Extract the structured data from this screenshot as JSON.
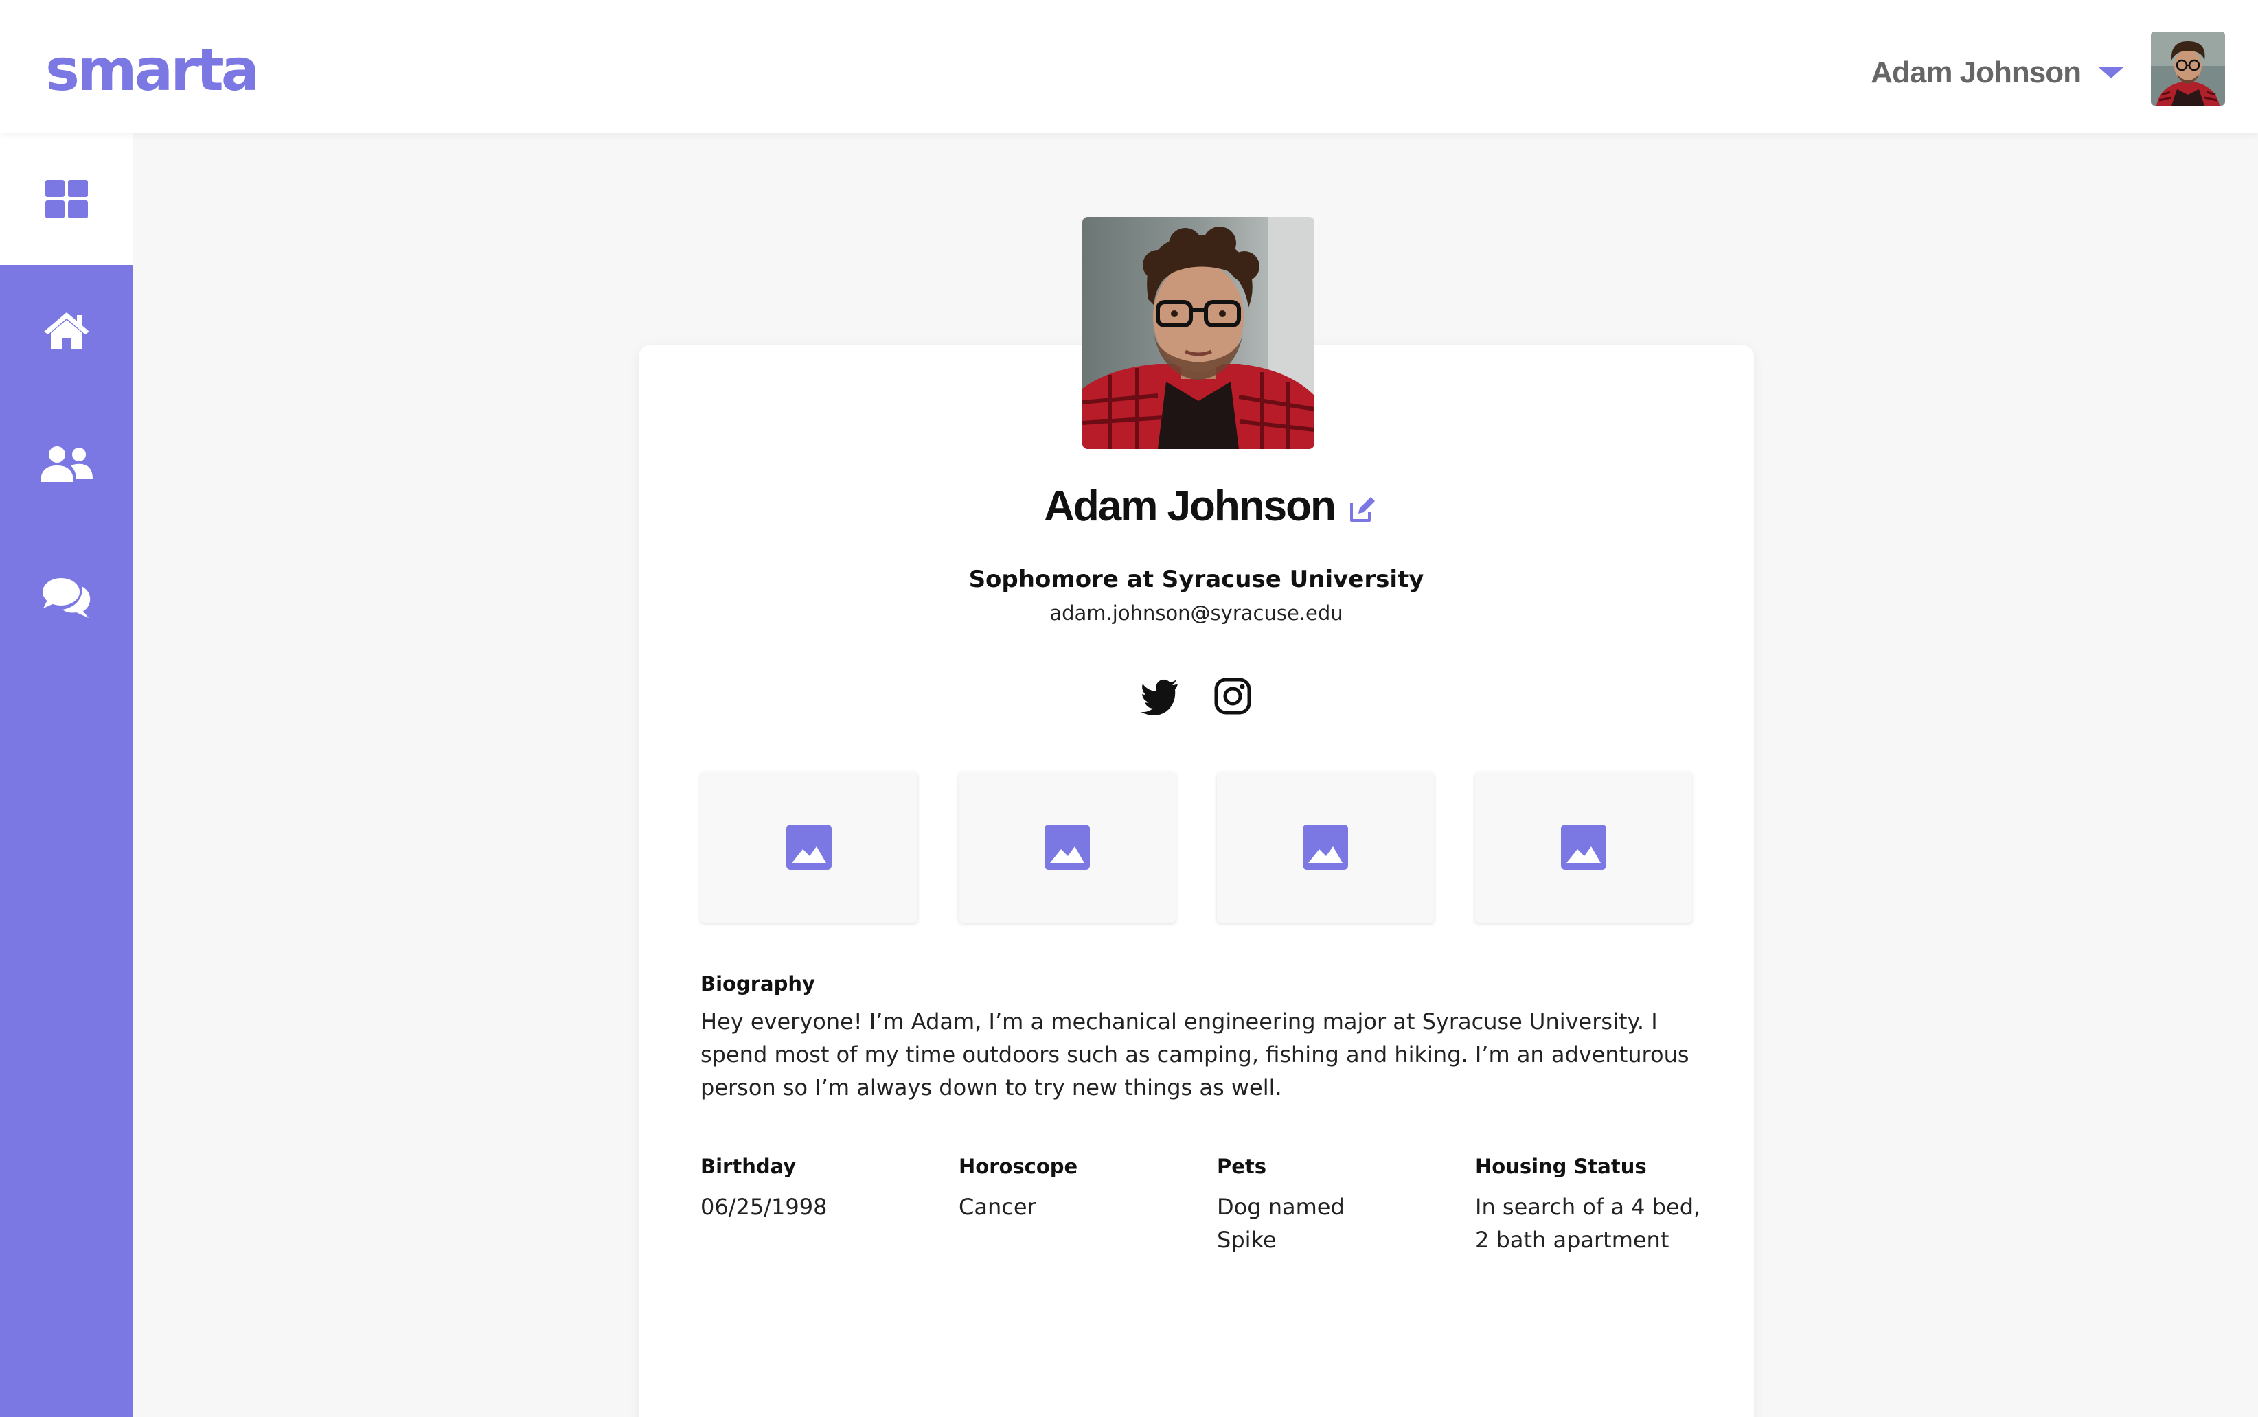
{
  "app": {
    "logo": "smarta",
    "accent_color": "#7b78e4"
  },
  "header": {
    "user_name": "Adam Johnson",
    "dropdown_icon": "caret-down-icon",
    "avatar_icon": "user-avatar"
  },
  "sidebar": {
    "items": [
      {
        "name": "dashboard",
        "icon": "grid-icon",
        "active": true
      },
      {
        "name": "home",
        "icon": "home-icon"
      },
      {
        "name": "people",
        "icon": "users-icon"
      },
      {
        "name": "messages",
        "icon": "chat-bubbles-icon"
      }
    ]
  },
  "profile": {
    "name": "Adam Johnson",
    "edit_icon": "edit-icon",
    "subtitle": "Sophomore at Syracuse University",
    "email": "adam.johnson@syracuse.edu",
    "socials": [
      {
        "name": "twitter",
        "icon": "twitter-icon"
      },
      {
        "name": "instagram",
        "icon": "instagram-icon"
      }
    ],
    "gallery_icon": "image-placeholder-icon",
    "biography": {
      "label": "Biography",
      "text": "Hey everyone! I’m Adam, I’m a mechanical engineering major at Syracuse University. I spend most of my time outdoors such as camping, fishing and hiking. I’m an adventurous person so I’m always down to try new things as well."
    },
    "details": [
      {
        "label": "Birthday",
        "value": "06/25/1998"
      },
      {
        "label": "Horoscope",
        "value": "Cancer"
      },
      {
        "label": "Pets",
        "value": "Dog named Spike"
      },
      {
        "label": "Housing Status",
        "value": "In search of a 4 bed, 2 bath apartment"
      }
    ]
  }
}
